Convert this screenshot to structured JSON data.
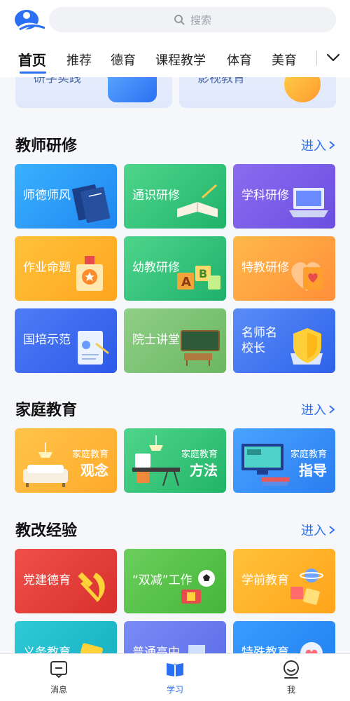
{
  "search": {
    "placeholder": "搜索"
  },
  "tabs": [
    {
      "label": "首页"
    },
    {
      "label": "推荐"
    },
    {
      "label": "德育"
    },
    {
      "label": "课程教学"
    },
    {
      "label": "体育"
    },
    {
      "label": "美育"
    }
  ],
  "prev_cards": [
    {
      "label": "研学实践"
    },
    {
      "label": "影视教育"
    }
  ],
  "sections": {
    "teacher": {
      "title": "教师研修",
      "enter": "进入",
      "cards": [
        {
          "label": "师德师风"
        },
        {
          "label": "通识研修"
        },
        {
          "label": "学科研修"
        },
        {
          "label": "作业命题"
        },
        {
          "label": "幼教研修"
        },
        {
          "label": "特教研修"
        },
        {
          "label": "国培示范"
        },
        {
          "label": "院士讲堂"
        },
        {
          "label": "名师名校长"
        }
      ]
    },
    "family": {
      "title": "家庭教育",
      "enter": "进入",
      "cards": [
        {
          "sub": "家庭教育",
          "big": "观念"
        },
        {
          "sub": "家庭教育",
          "big": "方法"
        },
        {
          "sub": "家庭教育",
          "big": "指导"
        }
      ]
    },
    "reform": {
      "title": "教改经验",
      "enter": "进入",
      "cards": [
        {
          "label": "党建德育"
        },
        {
          "label": "“双减”工作"
        },
        {
          "label": "学前教育"
        },
        {
          "label": "义务教育"
        },
        {
          "label": "普通高中"
        },
        {
          "label": "特殊教育"
        }
      ]
    }
  },
  "bottom_nav": [
    {
      "label": "消息",
      "icon": "message-icon"
    },
    {
      "label": "学习",
      "icon": "book-icon"
    },
    {
      "label": "我",
      "icon": "profile-icon"
    }
  ],
  "colors": {
    "accent": "#2b6ff2"
  }
}
